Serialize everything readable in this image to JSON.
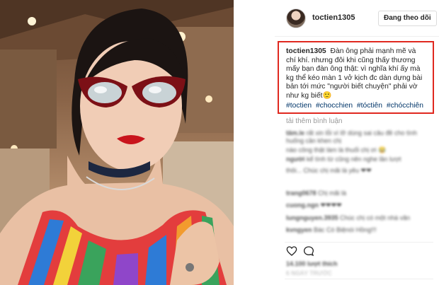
{
  "post": {
    "username": "toctien1305",
    "follow_label": "Đang theo dõi",
    "caption_user": "toctien1305",
    "caption_text": "Đàn ông phải mạnh mẽ và chí khí. nhưng đôi khi cũng thấy thương mấy bạn đàn ông thật: vì nghĩa khí ấy mà kg thể kéo màn 1 vở kịch đc dàn dựng bài bản tới mức \"người biết chuyện\" phải vờ như kg biết🙂",
    "hashtags": [
      "#toctien",
      "#chocchien",
      "#tóctiên",
      "#chócchiên"
    ],
    "load_more": "tải thêm bình luận",
    "likes": "14.100 lượt thích",
    "timestamp": "6 NGÀY TRƯỚC"
  },
  "comments": [
    {
      "user": "tâm.le",
      "text": "rất xin lỗi vì lỡ dùng sai câu đề cho tình huống cần khen chị"
    },
    {
      "user": "",
      "text": "nào công thật làm là thuối chị ơi 😂"
    },
    {
      "user": "người",
      "text": "kể tình từ cũng nên nghe lần lượt"
    },
    {
      "user": "",
      "text": "thôi... Chúc chị mãi là yêu ❤❤"
    },
    {
      "user": "trang0678",
      "text": "Chị mãi là"
    },
    {
      "user": "cuong.ngn",
      "text": "❤❤❤❤"
    },
    {
      "user": "lungnguyen.3935",
      "text": "Chúc chị có một nhà văn"
    },
    {
      "user": "kvngyen",
      "text": "Bác Có Biệnói Hồng!!!"
    }
  ],
  "colors": {
    "highlight_border": "#e0281f",
    "hashtag": "#003569",
    "muted": "#999999"
  },
  "icons": {
    "like": "heart-icon",
    "comment": "comment-bubble-icon"
  }
}
